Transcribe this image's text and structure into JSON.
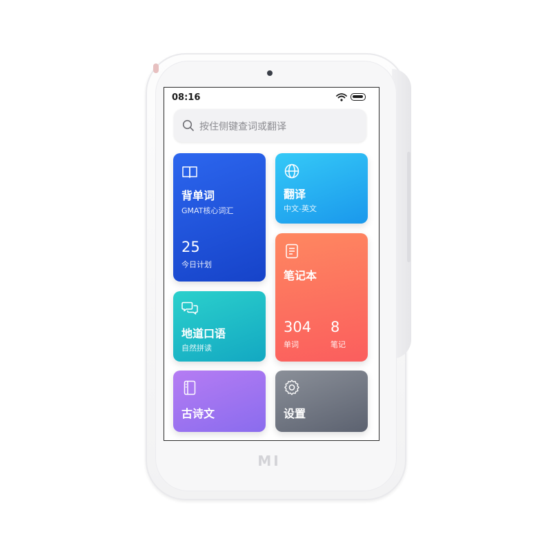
{
  "status_bar": {
    "time": "08:16"
  },
  "search": {
    "placeholder": "按住侧键查词或翻译"
  },
  "logo": {
    "text": "MI"
  },
  "cards": {
    "vocab": {
      "title": "背单词",
      "subtitle": "GMAT核心词汇",
      "count": "25",
      "count_label": "今日计划",
      "icon": "book-icon"
    },
    "translate": {
      "title": "翻译",
      "subtitle": "中文-英文",
      "icon": "globe-icon"
    },
    "notes": {
      "title": "笔记本",
      "words_count": "304",
      "words_label": "单词",
      "notes_count": "8",
      "notes_label": "笔记",
      "icon": "notebook-icon"
    },
    "oral": {
      "title": "地道口语",
      "subtitle": "自然拼读",
      "icon": "chat-bubbles-icon"
    },
    "poem": {
      "title": "古诗文",
      "icon": "scroll-book-icon"
    },
    "settings": {
      "title": "设置",
      "icon": "gear-icon"
    }
  },
  "colors": {
    "vocab": "#2358e0",
    "translate": "#28b2f2",
    "notes": "#fc6f5f",
    "oral": "#1fbcc7",
    "poem": "#a274f1",
    "settings": "#717785"
  }
}
